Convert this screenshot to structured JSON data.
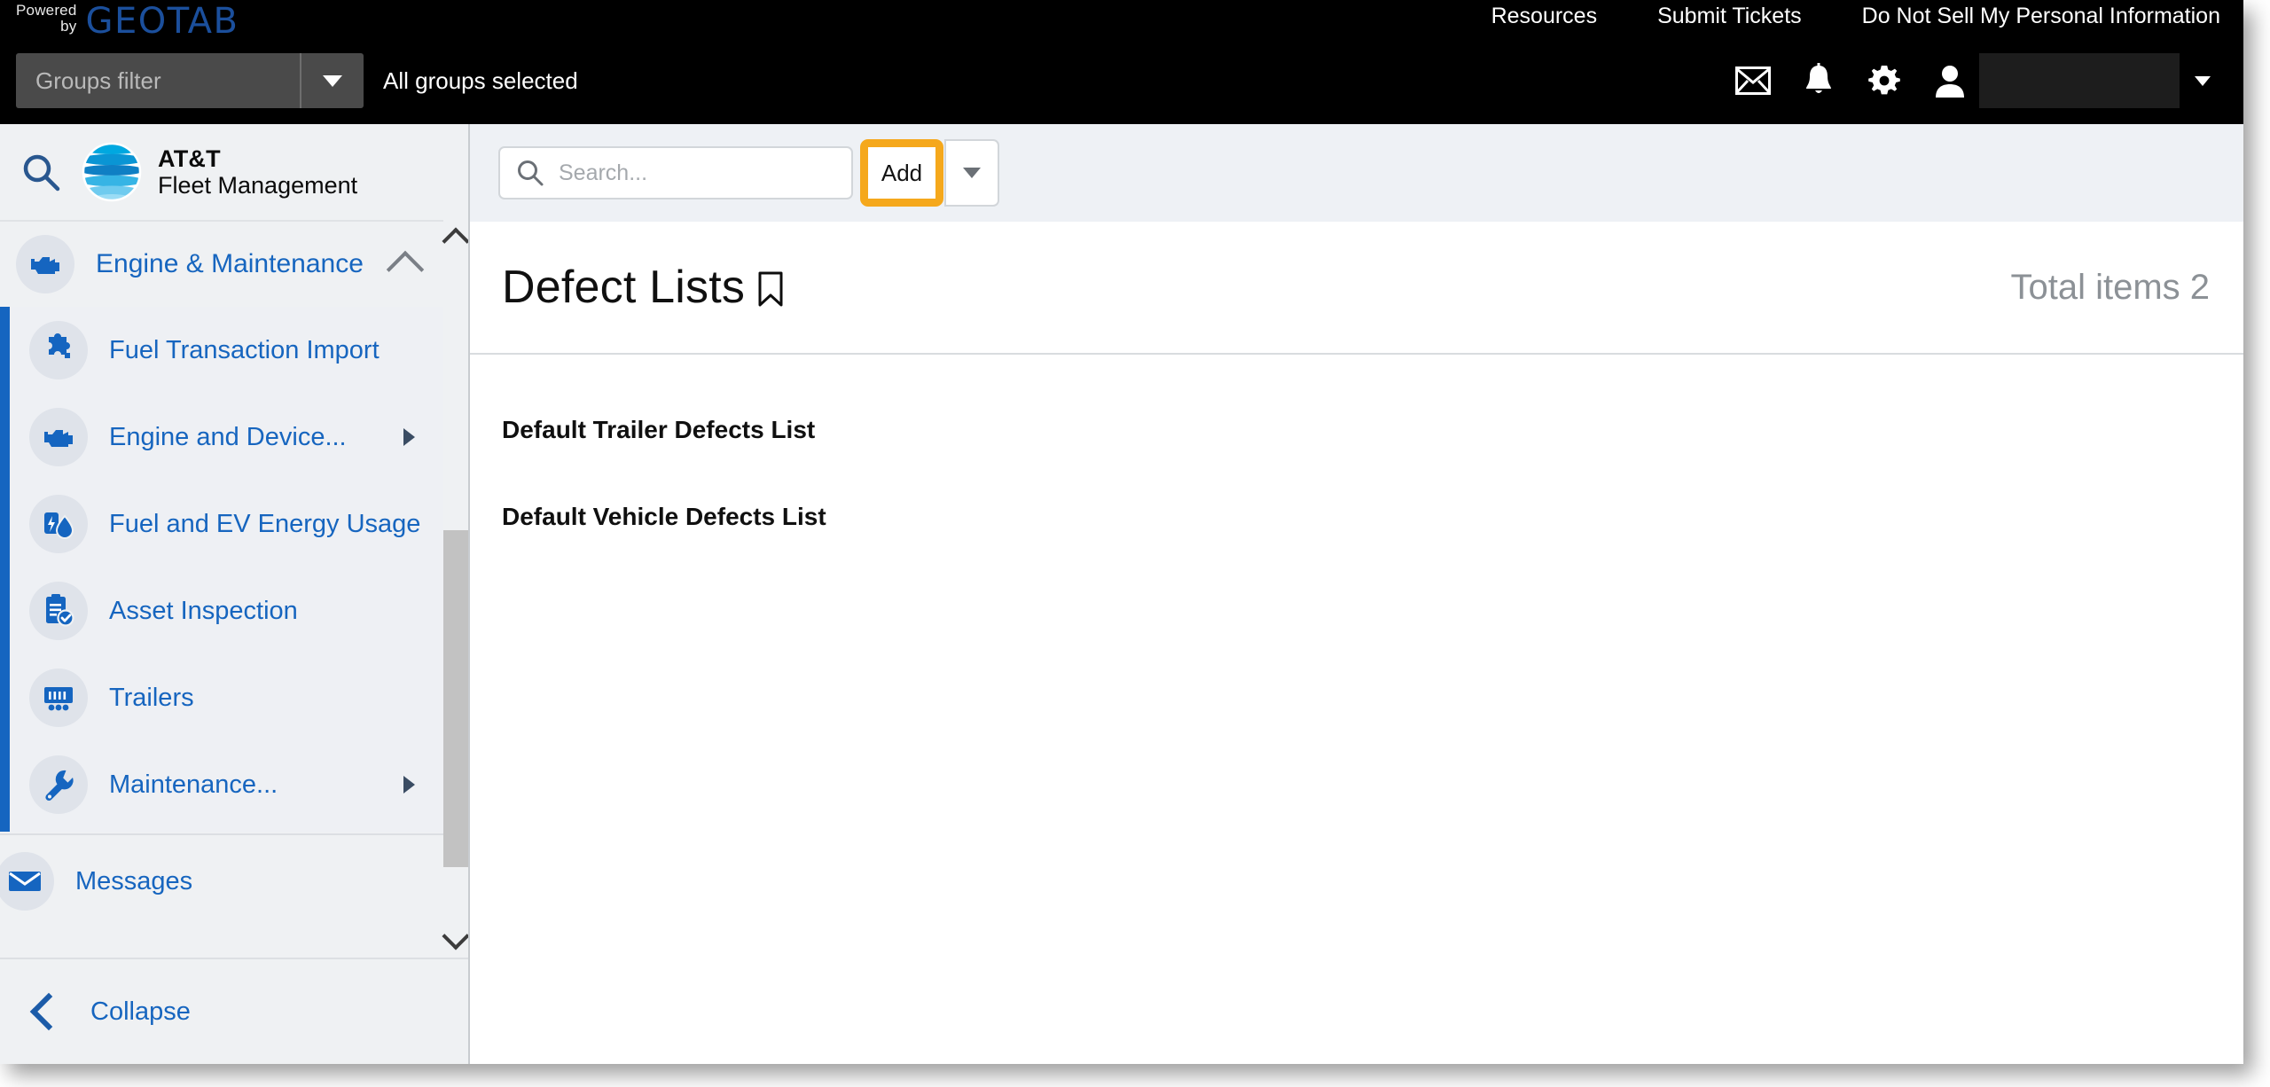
{
  "topbar": {
    "powered_line1": "Powered",
    "powered_line2": "by",
    "brand": "GEOTAB",
    "groups_filter_placeholder": "Groups filter",
    "groups_selected": "All groups selected",
    "links": [
      {
        "label": "Resources"
      },
      {
        "label": "Submit Tickets"
      },
      {
        "label": "Do Not Sell My Personal Information"
      }
    ],
    "icons": [
      {
        "name": "mail-icon"
      },
      {
        "name": "bell-icon"
      },
      {
        "name": "gear-icon"
      },
      {
        "name": "user-icon"
      }
    ],
    "user_name": ""
  },
  "sidebar": {
    "search_icon": "search-icon",
    "brand_line1": "AT&T",
    "brand_line2": "Fleet Management",
    "group": {
      "label": "Engine & Maintenance",
      "icon": "engine-icon",
      "expanded": true
    },
    "items": [
      {
        "label": "Fuel Transaction Import",
        "icon": "puzzle-icon",
        "has_submenu": false
      },
      {
        "label": "Engine and Device...",
        "icon": "engine-icon",
        "has_submenu": true
      },
      {
        "label": "Fuel and EV Energy Usage",
        "icon": "fuel-ev-icon",
        "has_submenu": false
      },
      {
        "label": "Asset Inspection",
        "icon": "clipboard-check-icon",
        "has_submenu": false
      },
      {
        "label": "Trailers",
        "icon": "trailer-icon",
        "has_submenu": false
      },
      {
        "label": "Maintenance...",
        "icon": "wrench-icon",
        "has_submenu": true
      }
    ],
    "standalone": {
      "label": "Messages",
      "icon": "envelope-icon"
    },
    "collapse_label": "Collapse"
  },
  "toolbar": {
    "search_placeholder": "Search...",
    "search_value": "",
    "add_label": "Add",
    "add_highlighted": true,
    "highlight_color": "#f5a81c"
  },
  "page": {
    "title": "Defect Lists",
    "bookmark_icon": "bookmark-icon",
    "total_items_label": "Total items 2"
  },
  "list": {
    "rows": [
      {
        "name": "Default Trailer Defects List"
      },
      {
        "name": "Default Vehicle Defects List"
      }
    ]
  },
  "colors": {
    "accent_blue": "#1565c0",
    "link_blue": "#1665bf",
    "highlight_amber": "#f5a81c",
    "topbar_black": "#000000",
    "sidebar_bg": "#eff1f3"
  }
}
